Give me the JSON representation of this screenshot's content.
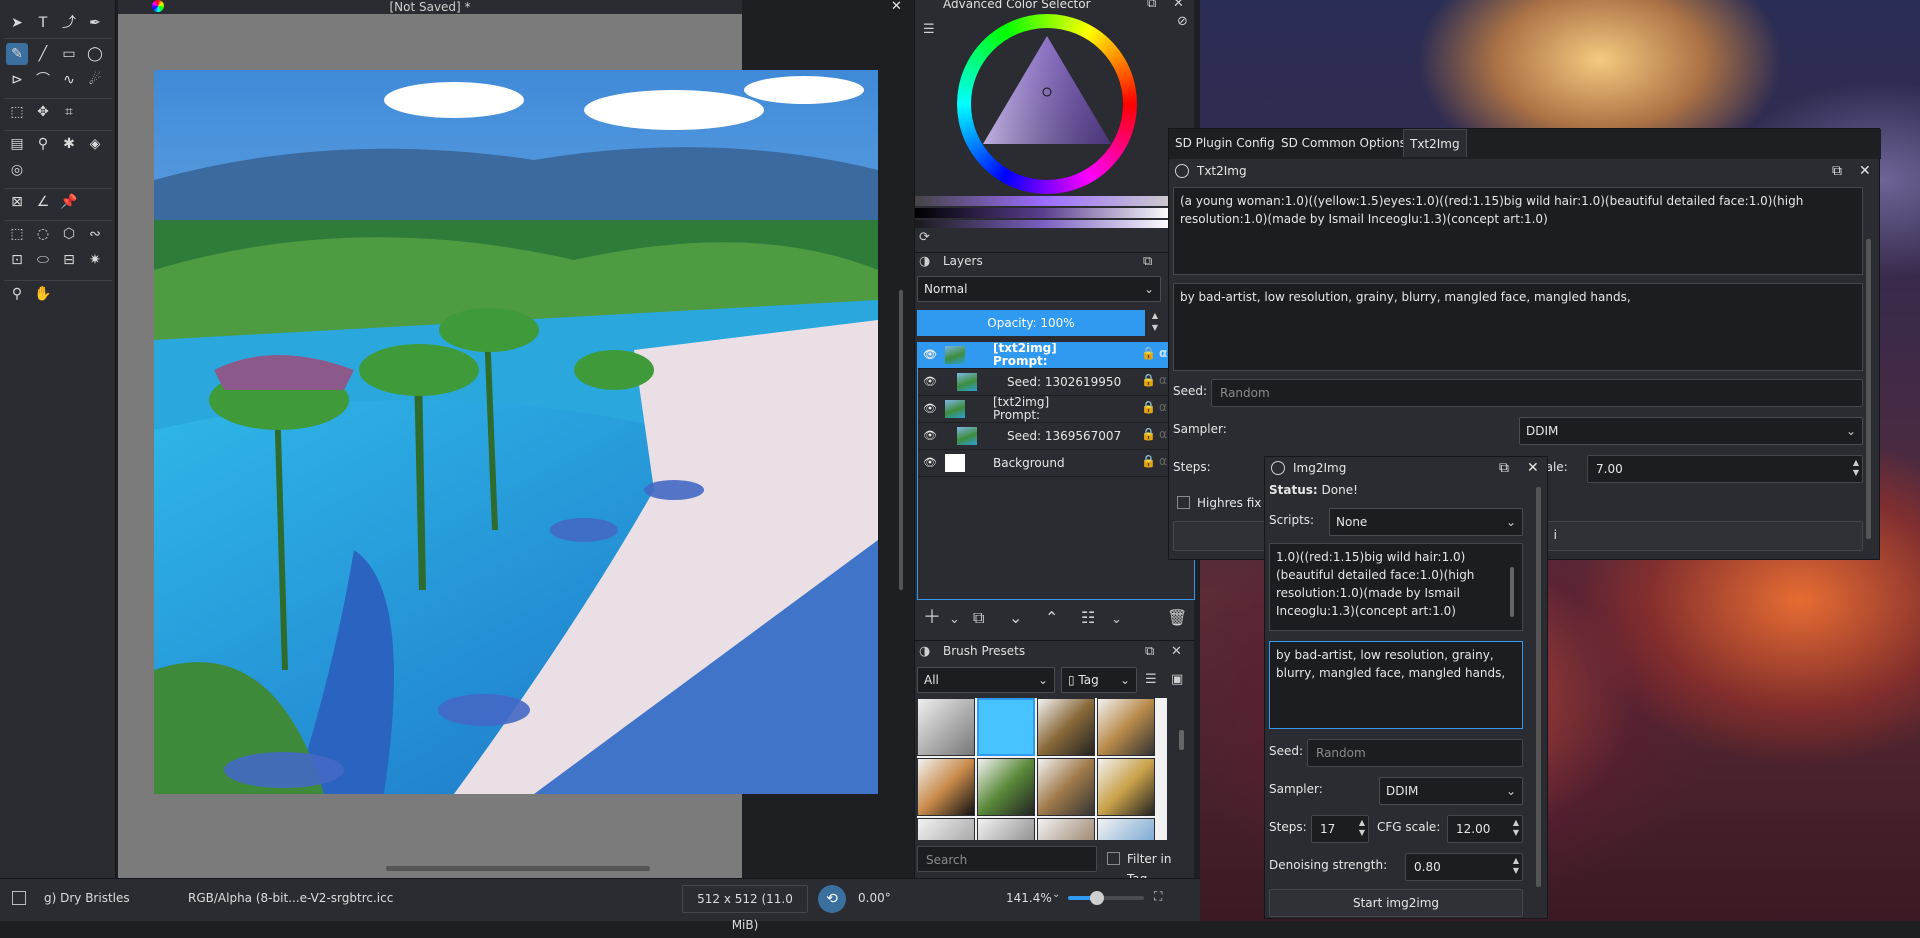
{
  "canvas": {
    "title": "[Not Saved]  *"
  },
  "status_bar": {
    "brush": "g) Dry Bristles",
    "color_profile": "RGB/Alpha (8-bit...e-V2-srgbtrc.icc",
    "image_size": "512 x 512 (11.0 MiB)",
    "rotation": "0.00°",
    "zoom": "141.4%"
  },
  "color_selector": {
    "title": "Advanced Color Selector"
  },
  "layers": {
    "title": "Layers",
    "blend_mode": "Normal",
    "opacity_label": "Opacity:  100%",
    "items": [
      {
        "name": "[txt2img]",
        "sub": "Prompt:",
        "selected": true
      },
      {
        "name": "Seed: 1302619950",
        "sub": "",
        "selected": false
      },
      {
        "name": "[txt2img]",
        "sub": "Prompt:",
        "selected": false
      },
      {
        "name": "Seed: 1369567007",
        "sub": "",
        "selected": false
      },
      {
        "name": "Background",
        "sub": "",
        "selected": false
      }
    ]
  },
  "brush_presets": {
    "title": "Brush Presets",
    "filter": "All",
    "tag_label": "Tag",
    "search_placeholder": "Search",
    "filter_in_tag": "Filter in Tag"
  },
  "sd_tabs": [
    "SD Plugin Config",
    "SD Common Options",
    "Txt2Img"
  ],
  "txt2img": {
    "title": "Txt2Img",
    "prompt": "(a young woman:1.0)((yellow:1.5)eyes:1.0)((red:1.15)big wild hair:1.0)(beautiful detailed face:1.0)(high resolution:1.0)(made by Ismail Inceoglu:1.3)(concept art:1.0)",
    "negative_prompt": "by bad-artist, low resolution, grainy, blurry, mangled face, mangled hands,",
    "seed_label": "Seed:",
    "seed_placeholder": "Random",
    "sampler_label": "Sampler:",
    "sampler_value": "DDIM",
    "steps_label": "Steps:",
    "cfg_label": "cale:",
    "cfg_value": "7.00",
    "highres_label": "Highres fix",
    "start_tail": "i"
  },
  "img2img": {
    "title": "Img2Img",
    "status_label": "Status:",
    "status_value": "Done!",
    "scripts_label": "Scripts:",
    "scripts_value": "None",
    "prompt": "1.0)((red:1.15)big wild hair:1.0)(beautiful detailed face:1.0)(high resolution:1.0)(made by Ismail Inceoglu:1.3)(concept art:1.0)",
    "negative_prompt": "by bad-artist, low resolution, grainy, blurry, mangled face, mangled hands,",
    "seed_label": "Seed:",
    "seed_placeholder": "Random",
    "sampler_label": "Sampler:",
    "sampler_value": "DDIM",
    "steps_label": "Steps:",
    "steps_value": "17",
    "cfg_label": "CFG scale:",
    "cfg_value": "12.00",
    "denoise_label": "Denoising strength:",
    "denoise_value": "0.80",
    "start_button": "Start img2img"
  }
}
